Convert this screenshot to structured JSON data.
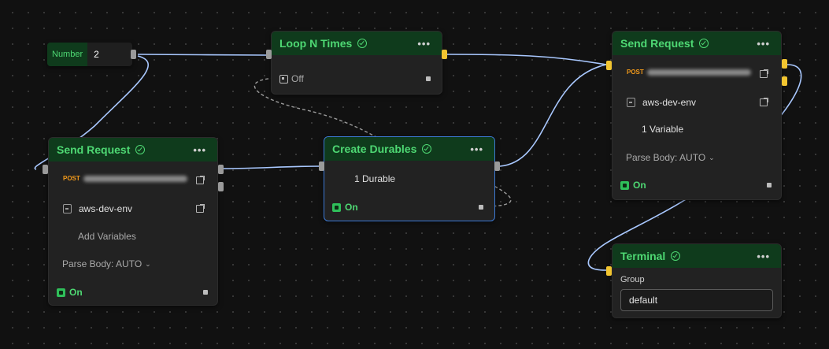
{
  "number_node": {
    "label": "Number",
    "value": "2"
  },
  "loop_node": {
    "title": "Loop N Times",
    "more": "•••",
    "toggle_label": "Off"
  },
  "create_node": {
    "title": "Create Durables",
    "more": "•••",
    "summary": "1 Durable",
    "on_label": "On"
  },
  "send_left": {
    "title": "Send Request",
    "more": "•••",
    "method": "POST",
    "env": "aws-dev-env",
    "variables": "Add Variables",
    "parse_body": "Parse Body: AUTO",
    "on_label": "On"
  },
  "send_right": {
    "title": "Send Request",
    "more": "•••",
    "method": "POST",
    "env": "aws-dev-env",
    "variables": "1 Variable",
    "parse_body": "Parse Body: AUTO",
    "on_label": "On"
  },
  "terminal_node": {
    "title": "Terminal",
    "more": "•••",
    "group_label": "Group",
    "group_value": "default"
  },
  "colors": {
    "header_bg": "#0f3b1c",
    "accent_green": "#4ed873",
    "port_yellow": "#f2c530",
    "wire": "#a9c8ff",
    "selection": "#3d7ad6",
    "method_orange": "#f29a1b"
  },
  "icons": [
    "check-icon",
    "more-icon",
    "external-link-icon",
    "environment-icon",
    "toggle-icon",
    "chevron-down-icon"
  ]
}
